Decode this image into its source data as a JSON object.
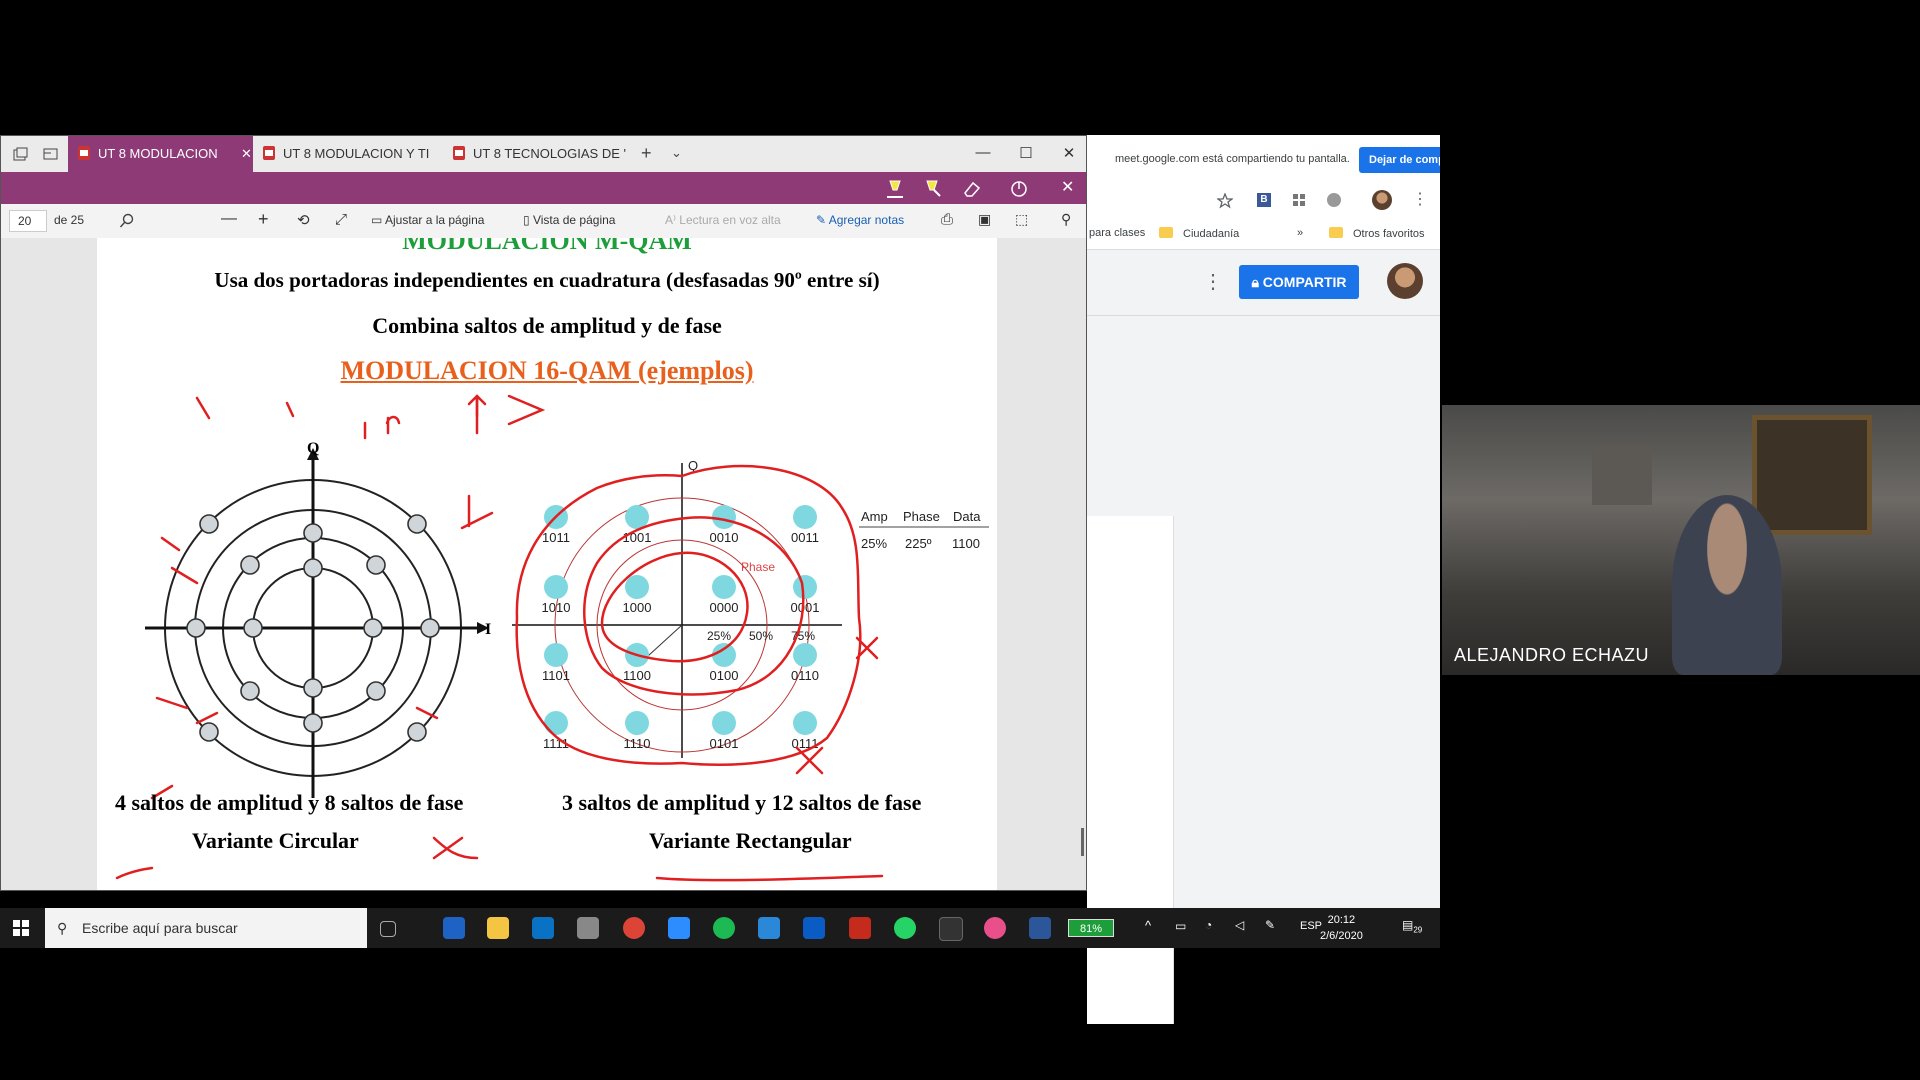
{
  "edge": {
    "tabs": [
      {
        "label": "UT 8 MODULACION",
        "active": true
      },
      {
        "label": "UT 8 MODULACION Y TI",
        "active": false
      },
      {
        "label": "UT 8 TECNOLOGIAS DE '",
        "active": false
      }
    ],
    "toolbar": {
      "page_number": "20",
      "page_total": "de 25",
      "fit_page": "Ajustar a la página",
      "page_view": "Vista de página",
      "read_aloud": "Lectura en voz alta",
      "add_notes": "Agregar notas"
    }
  },
  "slide": {
    "title_partial": "MODULACION M-QAM",
    "line1": "Usa dos portadoras independientes en cuadratura (desfasadas 90º entre sí)",
    "line2": "Combina saltos de amplitud y de fase",
    "heading": "MODULACION 16-QAM (ejemplos)",
    "left_caption": "4 saltos de amplitud y 8 saltos de fase",
    "left_variant": "Variante Circular",
    "right_caption": "3 saltos de amplitud y 12 saltos de fase",
    "right_variant": "Variante Rectangular",
    "axis_q": "Q",
    "axis_i": "I",
    "table_headers": [
      "Amp",
      "Phase",
      "Data"
    ],
    "table_row": [
      "25%",
      "225º",
      "1100"
    ],
    "phase_label": "Phase",
    "pct_labels": [
      "25%",
      "50%",
      "75%"
    ],
    "codes": [
      "1011",
      "1001",
      "0010",
      "0011",
      "1010",
      "1000",
      "0000",
      "0001",
      "1101",
      "1100",
      "0100",
      "0110",
      "1111",
      "1110",
      "0101",
      "0111"
    ]
  },
  "chrome": {
    "share_notice": "meet.google.com está compartiendo tu pantalla.",
    "share_button": "Dejar de compartir",
    "bookmarks": [
      "para clases",
      "Ciudadanía",
      "»",
      "Otros favoritos"
    ],
    "share_doc_button": "COMPARTIR"
  },
  "taskbar": {
    "search_placeholder": "Escribe aquí para buscar",
    "battery": "81%",
    "language": "ESP",
    "time": "20:12",
    "date": "2/6/2020",
    "notifications": "29"
  },
  "meet": {
    "participant_name": "ALEJANDRO ECHAZU"
  },
  "colors": {
    "edge_accent": "#8e3a77",
    "google_blue": "#1a73e8",
    "annotation_red": "#e02020",
    "qam_point": "#7fd8e0"
  }
}
